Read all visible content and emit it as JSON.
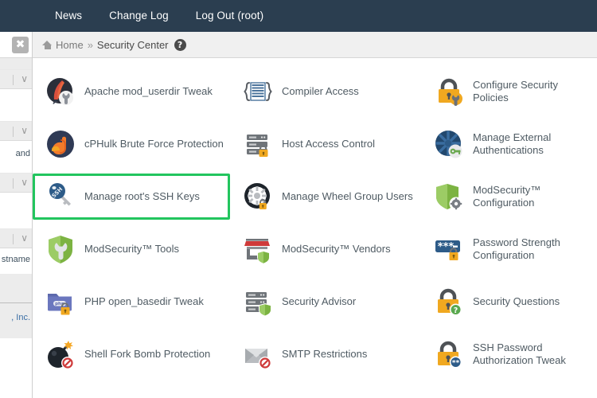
{
  "topnav": {
    "items": [
      {
        "label": "News",
        "name": "nav-news"
      },
      {
        "label": "Change Log",
        "name": "nav-change-log"
      },
      {
        "label": "Log Out (root)",
        "name": "nav-log-out"
      }
    ],
    "background": "#2b3e50"
  },
  "leftpanel": {
    "close_label": "✖",
    "fragments": [
      {
        "text": "and"
      },
      {
        "text": "stname"
      },
      {
        "text": ", Inc.",
        "link": true
      }
    ]
  },
  "breadcrumb": {
    "home": "Home",
    "separator": "»",
    "current": "Security Center",
    "help": "?"
  },
  "highlight_color": "#22c55e",
  "main": {
    "items": [
      {
        "label": "Apache mod_userdir Tweak",
        "icon": "apache-feather-wrench-icon",
        "column": 1,
        "row": 1
      },
      {
        "label": "Compiler Access",
        "icon": "compiler-braces-icon",
        "column": 2,
        "row": 1
      },
      {
        "label": "Configure Security Policies",
        "icon": "padlock-wrench-icon",
        "column": 3,
        "row": 1
      },
      {
        "label": "cPHulk Brute Force Protection",
        "icon": "flexed-bicep-icon",
        "column": 1,
        "row": 2
      },
      {
        "label": "Host Access Control",
        "icon": "server-lock-icon",
        "column": 2,
        "row": 2
      },
      {
        "label": "Manage External Authentications",
        "icon": "network-hub-key-icon",
        "column": 3,
        "row": 2
      },
      {
        "label": "Manage root's SSH Keys",
        "icon": "ssh-key-icon",
        "column": 1,
        "row": 3,
        "highlighted": true
      },
      {
        "label": "Manage Wheel Group Users",
        "icon": "wheel-gear-lock-icon",
        "column": 2,
        "row": 3
      },
      {
        "label": "ModSecurity™ Configuration",
        "icon": "green-shield-gear-icon",
        "column": 3,
        "row": 3
      },
      {
        "label": "ModSecurity™ Tools",
        "icon": "green-shield-wrench-icon",
        "column": 1,
        "row": 4
      },
      {
        "label": "ModSecurity™ Vendors",
        "icon": "storefront-shield-icon",
        "column": 2,
        "row": 4
      },
      {
        "label": "Password Strength Configuration",
        "icon": "password-asterisks-lock-icon",
        "column": 3,
        "row": 4
      },
      {
        "label": "PHP open_basedir Tweak",
        "icon": "php-folder-lock-icon",
        "column": 1,
        "row": 5
      },
      {
        "label": "Security Advisor",
        "icon": "server-shield-icon",
        "column": 2,
        "row": 5
      },
      {
        "label": "Security Questions",
        "icon": "padlock-question-icon",
        "column": 3,
        "row": 5
      },
      {
        "label": "Shell Fork Bomb Protection",
        "icon": "bomb-prohibited-icon",
        "column": 1,
        "row": 6
      },
      {
        "label": "SMTP Restrictions",
        "icon": "envelope-prohibited-icon",
        "column": 2,
        "row": 6
      },
      {
        "label": "SSH Password Authorization Tweak",
        "icon": "padlock-asterisk-badge-icon",
        "column": 3,
        "row": 6
      }
    ]
  }
}
